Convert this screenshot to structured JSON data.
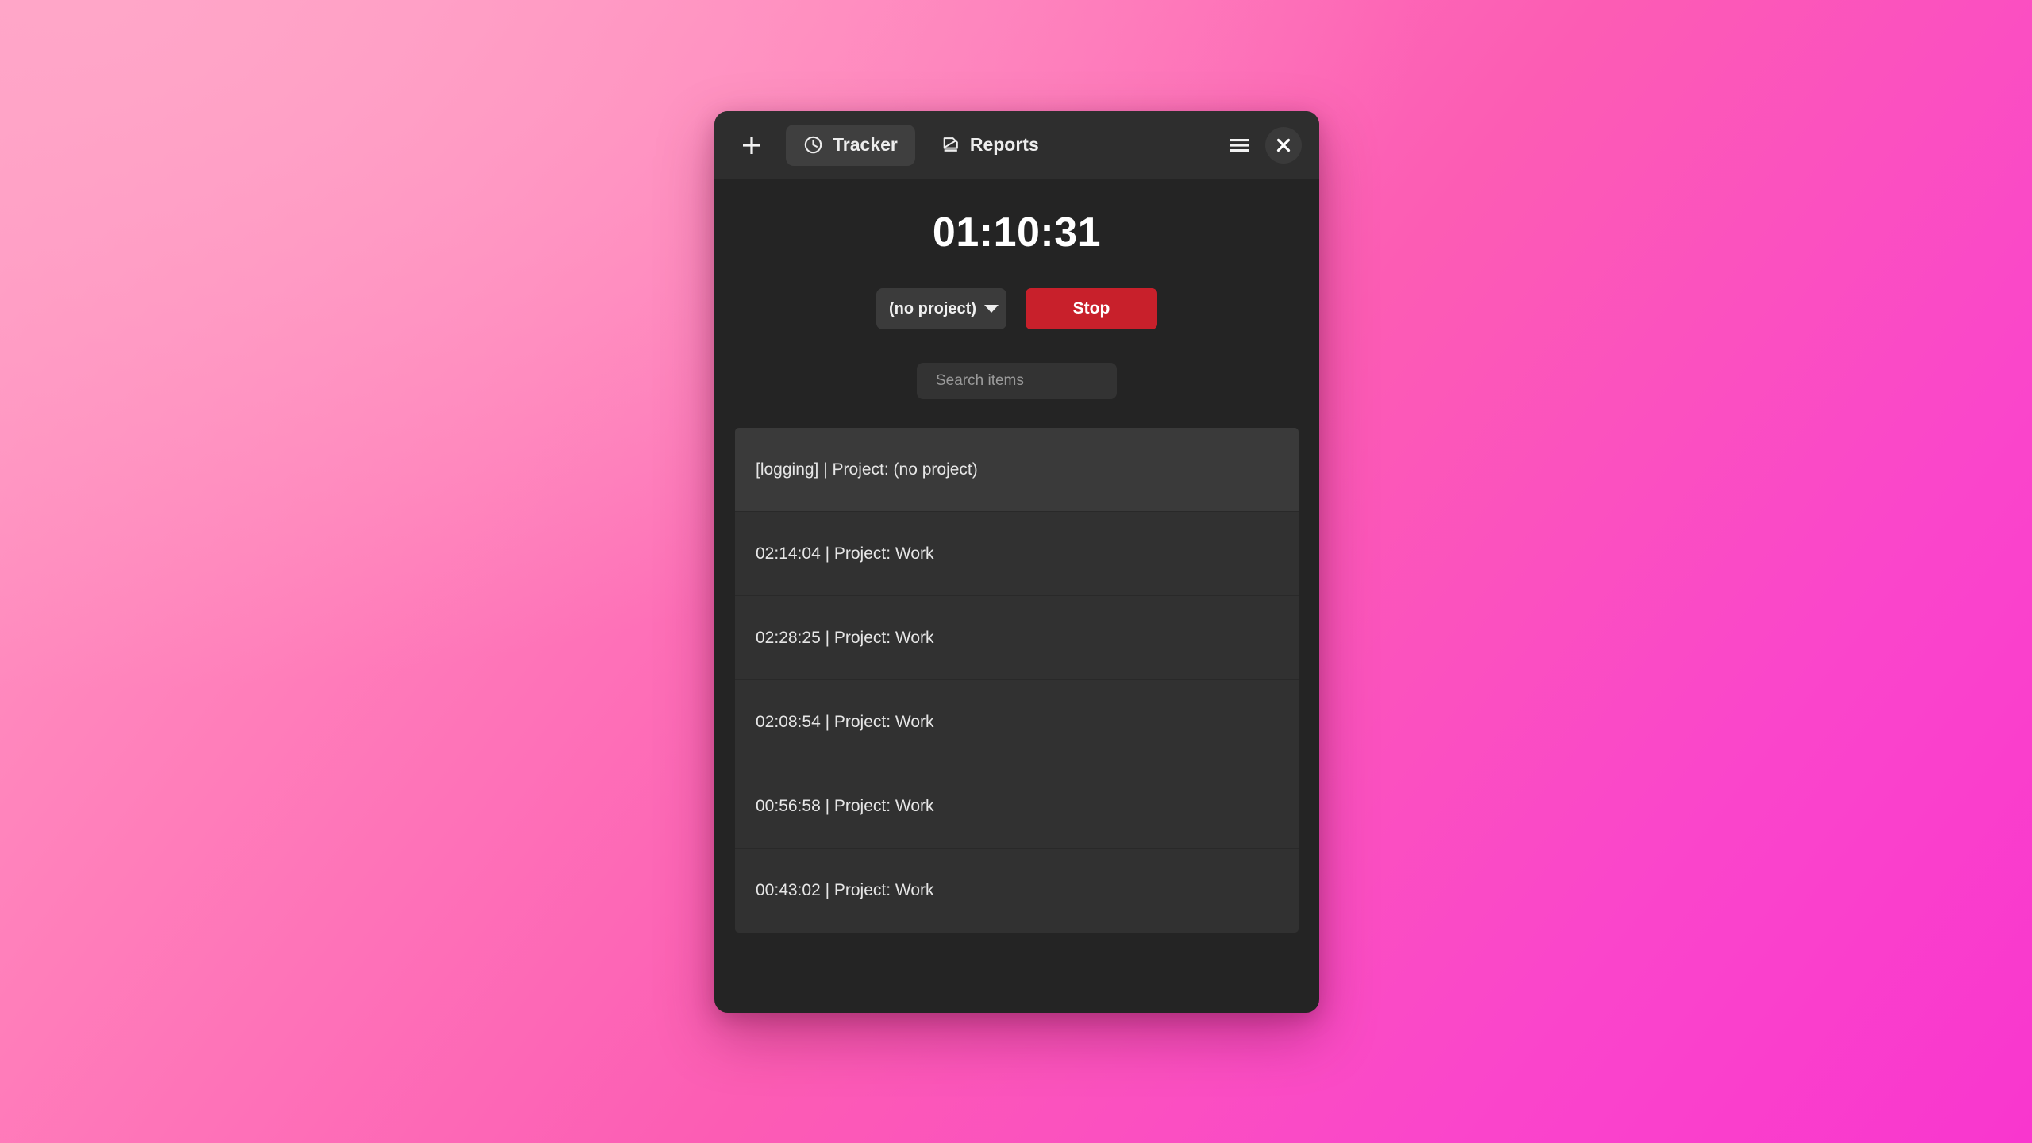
{
  "window": {
    "background_gradient_from": "#FF9EC4",
    "background_gradient_to": "#F936CE",
    "surface_color": "#242424",
    "titlebar_color": "#2E2E2E"
  },
  "titlebar": {
    "add_label": "+",
    "add_icon": "plus-icon",
    "menu_icon": "hamburger-menu-icon",
    "close_label": "×",
    "close_icon": "close-icon",
    "tabs": [
      {
        "label": "Tracker",
        "icon": "clock-icon",
        "active": true
      },
      {
        "label": "Reports",
        "icon": "report-document-icon",
        "active": false
      }
    ]
  },
  "tracker": {
    "elapsed_time": "01:10:31",
    "project_value": "(no project)",
    "project_caret_icon": "chevron-down-icon",
    "stop_label": "Stop",
    "stop_color": "#C8202B"
  },
  "search": {
    "icon": "search-icon",
    "value": "",
    "placeholder": "Search items"
  },
  "items": [
    {
      "label": "[logging] | Project: (no project)",
      "highlighted": true
    },
    {
      "label": "02:14:04 | Project: Work",
      "highlighted": false
    },
    {
      "label": "02:28:25 | Project: Work",
      "highlighted": false
    },
    {
      "label": "02:08:54 | Project: Work",
      "highlighted": false
    },
    {
      "label": "00:56:58 | Project: Work",
      "highlighted": false
    },
    {
      "label": "00:43:02 | Project: Work",
      "highlighted": false
    }
  ]
}
